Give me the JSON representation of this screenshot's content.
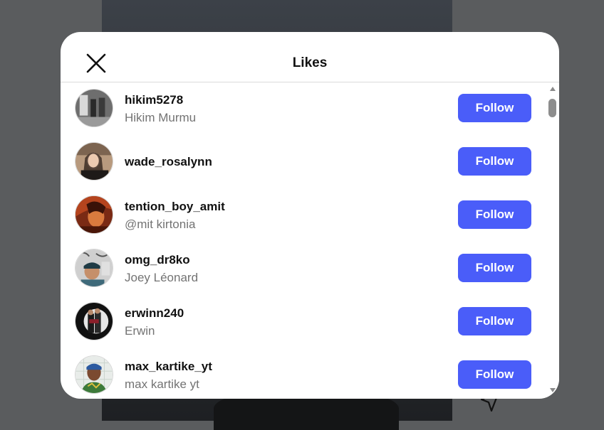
{
  "modal": {
    "title": "Likes",
    "close_icon": "close-icon",
    "follow_color": "#4a5df9"
  },
  "likes": [
    {
      "username": "hikim5278",
      "fullname": "Hikim Murmu",
      "follow_label": "Follow"
    },
    {
      "username": "wade_rosalynn",
      "fullname": "",
      "follow_label": "Follow"
    },
    {
      "username": "tention_boy_amit",
      "fullname": "@mit kirtonia",
      "follow_label": "Follow"
    },
    {
      "username": "omg_dr8ko",
      "fullname": "Joey Léonard",
      "follow_label": "Follow"
    },
    {
      "username": "erwinn240",
      "fullname": "Erwin",
      "follow_label": "Follow"
    },
    {
      "username": "max_kartike_yt",
      "fullname": "max kartike yt",
      "follow_label": "Follow"
    }
  ]
}
